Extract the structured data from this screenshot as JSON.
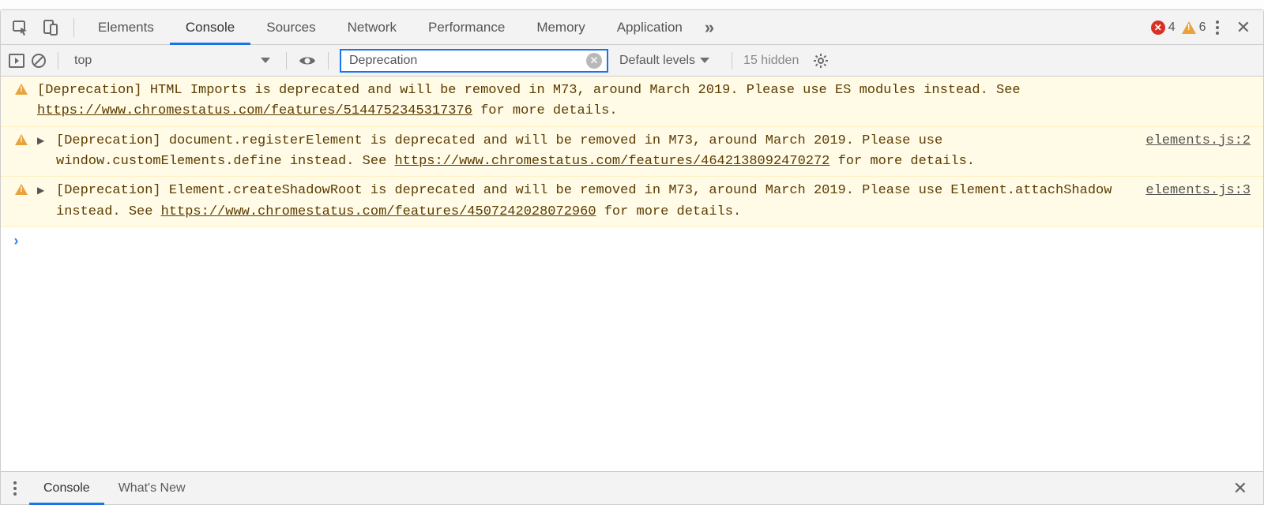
{
  "tabs": {
    "elements": "Elements",
    "console": "Console",
    "sources": "Sources",
    "network": "Network",
    "performance": "Performance",
    "memory": "Memory",
    "application": "Application"
  },
  "badges": {
    "errors": "4",
    "warnings": "6"
  },
  "toolbar": {
    "context": "top",
    "filter_value": "Deprecation",
    "levels_label": "Default levels",
    "hidden_label": "15 hidden"
  },
  "messages": [
    {
      "expandable": false,
      "text_pre": "[Deprecation] HTML Imports is deprecated and will be removed in M73, around March 2019. Please use ES modules instead. See ",
      "link": "https://www.chromestatus.com/features/5144752345317376",
      "text_post": " for more details.",
      "source": ""
    },
    {
      "expandable": true,
      "text_pre": "[Deprecation] document.registerElement is deprecated and will be removed in M73, around March 2019. Please use window.customElements.define instead. See ",
      "link": "https://www.chromestatus.com/features/4642138092470272",
      "text_post": " for more details.",
      "source": "elements.js:2"
    },
    {
      "expandable": true,
      "text_pre": "[Deprecation] Element.createShadowRoot is deprecated and will be removed in M73, around March 2019. Please use Element.attachShadow instead. See ",
      "link": "https://www.chromestatus.com/features/4507242028072960",
      "text_post": " for more details.",
      "source": "elements.js:3"
    }
  ],
  "drawer": {
    "console": "Console",
    "whatsnew": "What's New"
  }
}
